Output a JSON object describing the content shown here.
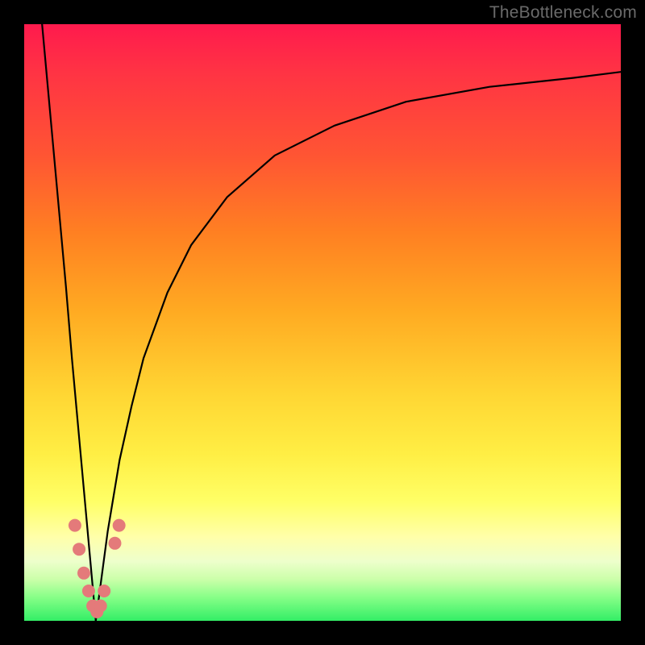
{
  "watermark": "TheBottleneck.com",
  "chart_data": {
    "type": "line",
    "title": "",
    "xlabel": "",
    "ylabel": "",
    "xlim": [
      0,
      100
    ],
    "ylim": [
      0,
      100
    ],
    "grid": false,
    "note": "Bottleneck-style V-curve. Two black curves meeting at a minimum near x≈12; left branch steep, right branch rising and flattening toward ~90. Pink rounded markers cluster near the minimum. Background is a vertical red→yellow→green gradient.",
    "series": [
      {
        "name": "left-branch",
        "color": "#000000",
        "x": [
          3,
          4,
          5,
          6,
          7,
          8,
          9,
          10,
          11,
          12
        ],
        "y": [
          100,
          89,
          78,
          67,
          56,
          44,
          33,
          22,
          11,
          0
        ]
      },
      {
        "name": "right-branch",
        "color": "#000000",
        "x": [
          12,
          14,
          16,
          18,
          20,
          24,
          28,
          34,
          42,
          52,
          64,
          78,
          92,
          100
        ],
        "y": [
          0,
          15,
          27,
          36,
          44,
          55,
          63,
          71,
          78,
          83,
          87,
          89.5,
          91,
          92
        ]
      },
      {
        "name": "markers",
        "type": "scatter",
        "color": "#e47a7a",
        "x": [
          8.5,
          9.2,
          10.0,
          10.8,
          11.5,
          12.2,
          12.8,
          13.4,
          15.2,
          15.9
        ],
        "y": [
          16,
          12,
          8,
          5,
          2.5,
          1.5,
          2.5,
          5,
          13,
          16
        ]
      }
    ]
  }
}
